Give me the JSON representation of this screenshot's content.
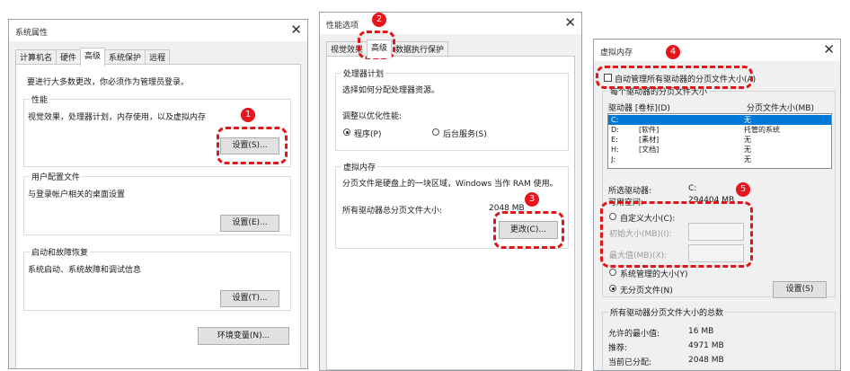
{
  "dlg1": {
    "title": "系统属性",
    "tabs": [
      "计算机名",
      "硬件",
      "高级",
      "系统保护",
      "远程"
    ],
    "admin_note": "要进行大多数更改，你必须作为管理员登录。",
    "perf": {
      "label": "性能",
      "desc": "视觉效果，处理器计划，内存使用，以及虚拟内存",
      "button": "设置(S)..."
    },
    "profile": {
      "label": "用户配置文件",
      "desc": "与登录帐户相关的桌面设置",
      "button": "设置(E)..."
    },
    "startup": {
      "label": "启动和故障恢复",
      "desc": "系统启动、系统故障和调试信息",
      "button": "设置(T)..."
    },
    "env_button": "环境变量(N)..."
  },
  "dlg2": {
    "title": "性能选项",
    "tabs": [
      "视觉效果",
      "高级",
      "数据执行保护"
    ],
    "cpu": {
      "label": "处理器计划",
      "desc": "选择如何分配处理器资源。",
      "adjust": "调整以优化性能:",
      "opt_programs": "程序(P)",
      "opt_services": "后台服务(S)"
    },
    "vm": {
      "label": "虚拟内存",
      "desc": "分页文件是硬盘上的一块区域，Windows 当作 RAM 使用。",
      "total_label": "所有驱动器总分页文件大小:",
      "total_value": "2048 MB",
      "button": "更改(C)..."
    }
  },
  "dlg3": {
    "title": "虚拟内存",
    "auto_manage": "自动管理所有驱动器的分页文件大小(A)",
    "per_drive_label": "每个驱动器的分页文件大小",
    "col_drive": "驱动器 [卷标](D)",
    "col_size": "分页文件大小(MB)",
    "drives": [
      {
        "drive": "C:",
        "label": "",
        "size": "无"
      },
      {
        "drive": "D:",
        "label": "[软件]",
        "size": "托管的系统"
      },
      {
        "drive": "E:",
        "label": "[素材]",
        "size": "无"
      },
      {
        "drive": "H:",
        "label": "[文档]",
        "size": "无"
      },
      {
        "drive": "J:",
        "label": "",
        "size": "无"
      }
    ],
    "selected_drive_label": "所选驱动器:",
    "selected_drive_value": "C:",
    "free_space_label": "可用空间:",
    "free_space_value": "294404 MB",
    "custom_size": "自定义大小(C):",
    "initial_size": "初始大小(MB)(I):",
    "max_size": "最大值(MB)(X):",
    "system_managed": "系统管理的大小(Y)",
    "no_paging": "无分页文件(N)",
    "set_button": "设置(S)",
    "total_group_label": "所有驱动器分页文件大小的总数",
    "min_allowed_label": "允许的最小值:",
    "min_allowed_value": "16 MB",
    "recommended_label": "推荐:",
    "recommended_value": "4971 MB",
    "current_label": "当前已分配:",
    "current_value": "2048 MB"
  },
  "badges": [
    "1",
    "2",
    "3",
    "4",
    "5"
  ],
  "highlight_color": "#e0161a"
}
